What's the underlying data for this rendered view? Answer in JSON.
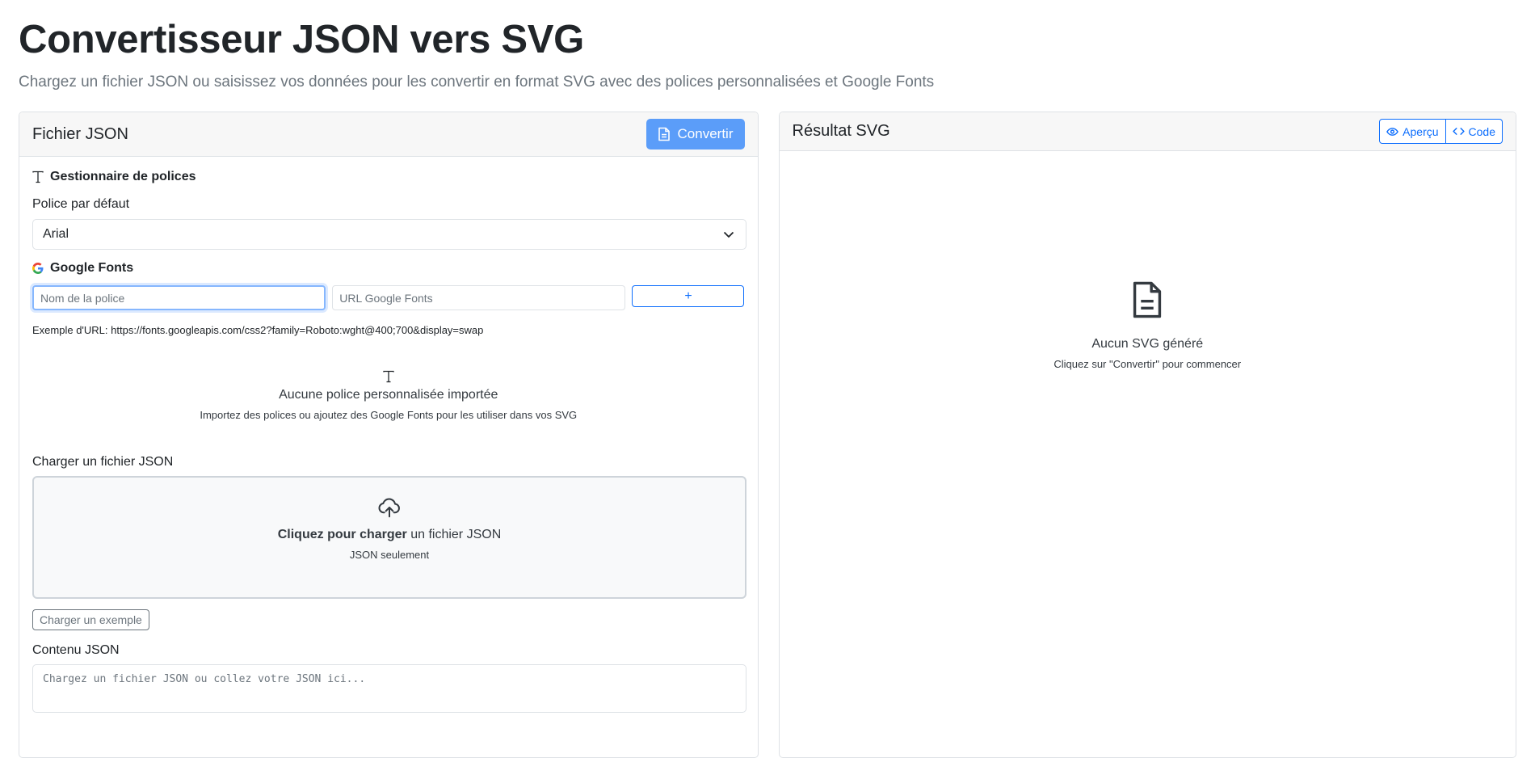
{
  "header": {
    "title": "Convertisseur JSON vers SVG",
    "subtitle": "Chargez un fichier JSON ou saisissez vos données pour les convertir en format SVG avec des polices personnalisées et Google Fonts"
  },
  "left_panel": {
    "title": "Fichier JSON",
    "convert_label": "Convertir",
    "font_manager": {
      "title": "Gestionnaire de polices",
      "default_font_label": "Police par défaut",
      "default_font_value": "Arial"
    },
    "google_fonts": {
      "title": "Google Fonts",
      "name_placeholder": "Nom de la police",
      "url_placeholder": "URL Google Fonts",
      "add_label": "+",
      "example_url": "Exemple d'URL: https://fonts.googleapis.com/css2?family=Roboto:wght@400;700&display=swap"
    },
    "empty_fonts": {
      "title": "Aucune police personnalisée importée",
      "description": "Importez des polices ou ajoutez des Google Fonts pour les utiliser dans vos SVG"
    },
    "upload": {
      "label": "Charger un fichier JSON",
      "cta_bold": "Cliquez pour charger",
      "cta_rest": " un fichier JSON",
      "hint": "JSON seulement",
      "example_button": "Charger un exemple"
    },
    "json_content": {
      "label": "Contenu JSON",
      "placeholder": "Chargez un fichier JSON ou collez votre JSON ici..."
    }
  },
  "right_panel": {
    "title": "Résultat SVG",
    "preview_label": "Aperçu",
    "code_label": "Code",
    "empty_title": "Aucun SVG généré",
    "empty_hint": "Cliquez sur \"Convertir\" pour commencer"
  },
  "icons": {
    "convert": "file-text-icon",
    "font": "type-icon",
    "google": "google-icon",
    "select": "chevron-down-icon",
    "upload": "cloud-upload-icon",
    "preview": "eye-icon",
    "code": "code-icon",
    "empty_svg": "file-text-icon"
  },
  "colors": {
    "primary": "#0d6efd",
    "convert_button": "#5b9df9",
    "muted": "#6c757d"
  }
}
